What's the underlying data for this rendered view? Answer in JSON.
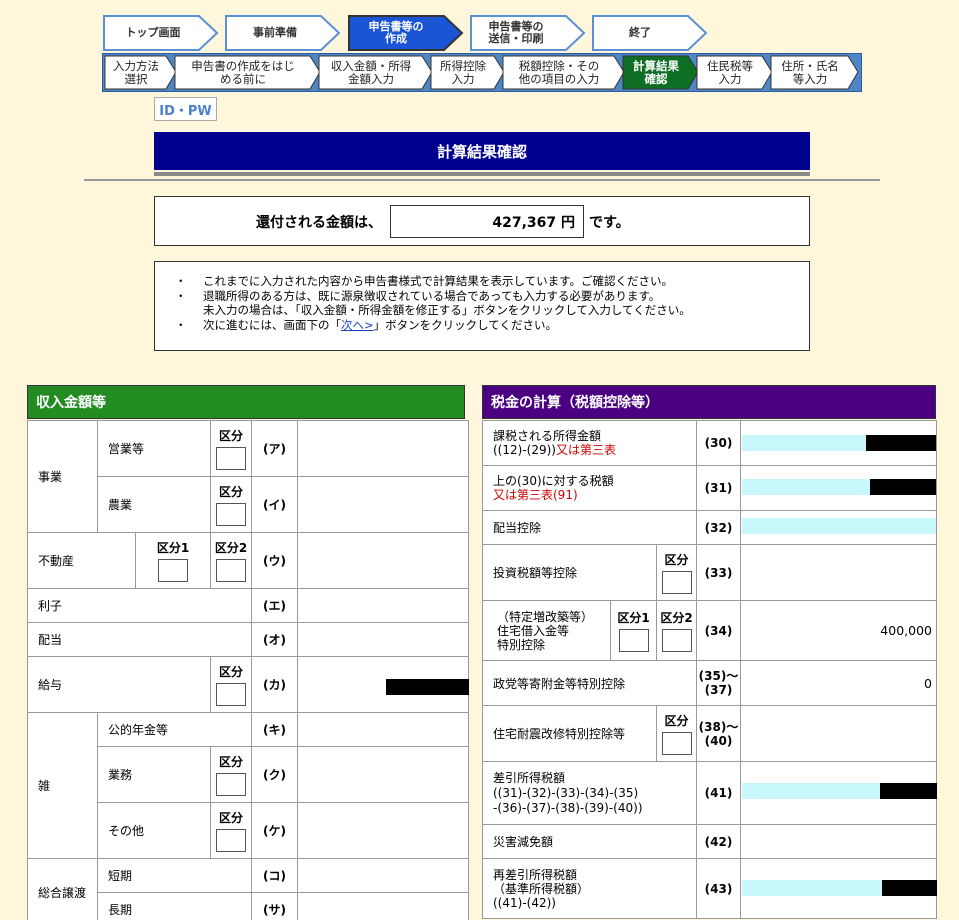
{
  "steps": [
    {
      "label": "トップ画面"
    },
    {
      "label": "事前準備"
    },
    {
      "label": "申告書等の\n作成"
    },
    {
      "label": "申告書等の\n送信・印刷"
    },
    {
      "label": "終了"
    }
  ],
  "substeps": [
    {
      "label": "入力方法\n選択"
    },
    {
      "label": "申告書の作成をはじ\nめる前に"
    },
    {
      "label": "収入金額・所得\n金額入力"
    },
    {
      "label": "所得控除\n入力"
    },
    {
      "label": "税額控除・その\n他の項目の入力"
    },
    {
      "label": "計算結果\n確認"
    },
    {
      "label": "住民税等\n入力"
    },
    {
      "label": "住所・氏名\n等入力"
    }
  ],
  "idpw_label": "ID・PW",
  "page_title": "計算結果確認",
  "refund": {
    "prefix": "還付される金額は、",
    "amount": "427,367 円",
    "suffix": "です。"
  },
  "notes": {
    "bullet": "・",
    "n1": "これまでに入力された内容から申告書様式で計算結果を表示しています。ご確認ください。",
    "n2a": "退職所得のある方は、既に源泉徴収されている場合であっても入力する必要があります。",
    "n2b": "未入力の場合は、「収入金額・所得金額を修正する」ボタンをクリックして入力してください。",
    "n3a": "次に進むには、画面下の「",
    "n3link": "次へ>",
    "n3b": "」ボタンをクリックしてください。"
  },
  "income": {
    "header": "収入金額等",
    "kubun": "区分",
    "kubun1": "区分1",
    "kubun2": "区分2",
    "jigyo": "事業",
    "eigyo": "営業等",
    "nogyo": "農業",
    "fudosan": "不動産",
    "rishi": "利子",
    "haito": "配当",
    "kyuyo": "給与",
    "zatsu": "雑",
    "nenkin": "公的年金等",
    "gyomu": "業務",
    "sonota": "その他",
    "sogo": "総合譲渡",
    "tanki": "短期",
    "choki": "長期",
    "codes": [
      "(ア)",
      "(イ)",
      "(ウ)",
      "(エ)",
      "(オ)",
      "(カ)",
      "(キ)",
      "(ク)",
      "(ケ)",
      "(コ)",
      "(サ)"
    ]
  },
  "tax": {
    "header": "税金の計算（税額控除等）",
    "kubun": "区分",
    "kubun1": "区分1",
    "kubun2": "区分2",
    "r30a": "課税される所得金額",
    "r30b": "((12)-(29))",
    "r30c": "又は第三表",
    "r31a": "上の(30)に対する税額",
    "r31b": "又は第三表(91)",
    "r32": "配当控除",
    "r33": "投資税額等控除",
    "r34a": "（特定増改築等）",
    "r34b": "住宅借入金等",
    "r34c": "特別控除",
    "r35": "政党等寄附金等特別控除",
    "r38": "住宅耐震改修特別控除等",
    "r41a": "差引所得税額",
    "r41b": "((31)-(32)-(33)-(34)-(35)",
    "r41c": "-(36)-(37)-(38)-(39)-(40))",
    "r42": "災害減免額",
    "r43a": "再差引所得税額",
    "r43b": "（基準所得税額）",
    "r43c": "((41)-(42))",
    "c30": "(30)",
    "c31": "(31)",
    "c32": "(32)",
    "c33": "(33)",
    "c34": "(34)",
    "c35a": "(35)～",
    "c35b": "(37)",
    "c38a": "(38)～",
    "c38b": "(40)",
    "c41": "(41)",
    "c42": "(42)",
    "c43": "(43)",
    "v34": "400,000",
    "v35": "0"
  },
  "colors": {
    "income_header": "#228b22",
    "tax_header": "#4b0082",
    "title_bg": "#000090",
    "active_step": "#1a55d6",
    "active_sub": "#0e6e24"
  }
}
